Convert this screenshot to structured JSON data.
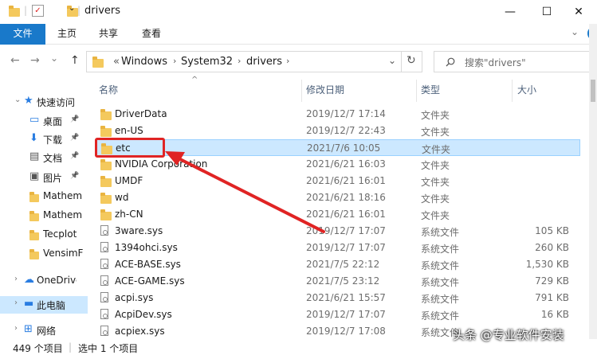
{
  "window": {
    "title": "drivers",
    "controls": {
      "minimize": "—",
      "maximize": "☐",
      "close": "✕"
    }
  },
  "ribbon": {
    "tabs": [
      "文件",
      "主页",
      "共享",
      "查看"
    ],
    "expand": "⌄",
    "help": "?"
  },
  "nav": {
    "back": "←",
    "forward": "→",
    "dropdown": "⌄",
    "up": "↑",
    "breadcrumbs": [
      "Windows",
      "System32",
      "drivers"
    ],
    "overflow": "«",
    "refresh": "↻",
    "search_placeholder": "搜索\"drivers\""
  },
  "sidebar": {
    "items": [
      {
        "label": "快速访问",
        "icon": "star-icon",
        "pinned": false
      },
      {
        "label": "桌面",
        "icon": "desktop-icon",
        "pinned": true
      },
      {
        "label": "下载",
        "icon": "download-icon",
        "pinned": true
      },
      {
        "label": "文档",
        "icon": "document-icon",
        "pinned": true
      },
      {
        "label": "图片",
        "icon": "picture-icon",
        "pinned": true
      },
      {
        "label": "Mathem",
        "icon": "folder-icon",
        "pinned": false
      },
      {
        "label": "Mathem",
        "icon": "folder-icon",
        "pinned": false
      },
      {
        "label": "Tecplot",
        "icon": "folder-icon",
        "pinned": false
      },
      {
        "label": "VensimF",
        "icon": "folder-icon",
        "pinned": false
      },
      {
        "label": "OneDrive",
        "icon": "cloud-icon",
        "pinned": false
      },
      {
        "label": "此电脑",
        "icon": "computer-icon",
        "pinned": false,
        "selected": true
      },
      {
        "label": "网络",
        "icon": "network-icon",
        "pinned": false
      }
    ]
  },
  "columns": {
    "name": "名称",
    "date": "修改日期",
    "type": "类型",
    "size": "大小"
  },
  "files": [
    {
      "name": "DriverData",
      "date": "2019/12/7 17:14",
      "type": "文件夹",
      "size": "",
      "kind": "folder"
    },
    {
      "name": "en-US",
      "date": "2019/12/7 22:43",
      "type": "文件夹",
      "size": "",
      "kind": "folder"
    },
    {
      "name": "etc",
      "date": "2021/7/6 10:05",
      "type": "文件夹",
      "size": "",
      "kind": "folder",
      "selected": true
    },
    {
      "name": "NVIDIA Corporation",
      "date": "2021/6/21 16:03",
      "type": "文件夹",
      "size": "",
      "kind": "folder"
    },
    {
      "name": "UMDF",
      "date": "2021/6/21 16:01",
      "type": "文件夹",
      "size": "",
      "kind": "folder"
    },
    {
      "name": "wd",
      "date": "2021/6/21 18:16",
      "type": "文件夹",
      "size": "",
      "kind": "folder"
    },
    {
      "name": "zh-CN",
      "date": "2021/6/21 16:01",
      "type": "文件夹",
      "size": "",
      "kind": "folder"
    },
    {
      "name": "3ware.sys",
      "date": "2019/12/7 17:07",
      "type": "系统文件",
      "size": "105 KB",
      "kind": "sys"
    },
    {
      "name": "1394ohci.sys",
      "date": "2019/12/7 17:07",
      "type": "系统文件",
      "size": "260 KB",
      "kind": "sys"
    },
    {
      "name": "ACE-BASE.sys",
      "date": "2021/7/5 22:12",
      "type": "系统文件",
      "size": "1,530 KB",
      "kind": "sys"
    },
    {
      "name": "ACE-GAME.sys",
      "date": "2021/7/5 23:12",
      "type": "系统文件",
      "size": "729 KB",
      "kind": "sys"
    },
    {
      "name": "acpi.sys",
      "date": "2021/6/21 15:57",
      "type": "系统文件",
      "size": "791 KB",
      "kind": "sys"
    },
    {
      "name": "AcpiDev.sys",
      "date": "2019/12/7 17:07",
      "type": "系统文件",
      "size": "16 KB",
      "kind": "sys"
    },
    {
      "name": "acpiex.sys",
      "date": "2019/12/7 17:08",
      "type": "系统文件",
      "size": "",
      "kind": "sys"
    }
  ],
  "status": {
    "count": "449 个项目",
    "selected": "选中 1 个项目"
  },
  "watermark": "头条 @专业软件安装",
  "colors": {
    "accent": "#1979ca",
    "selection": "#cce8ff",
    "annotation": "#e02424",
    "folder": "#f4c95d"
  }
}
